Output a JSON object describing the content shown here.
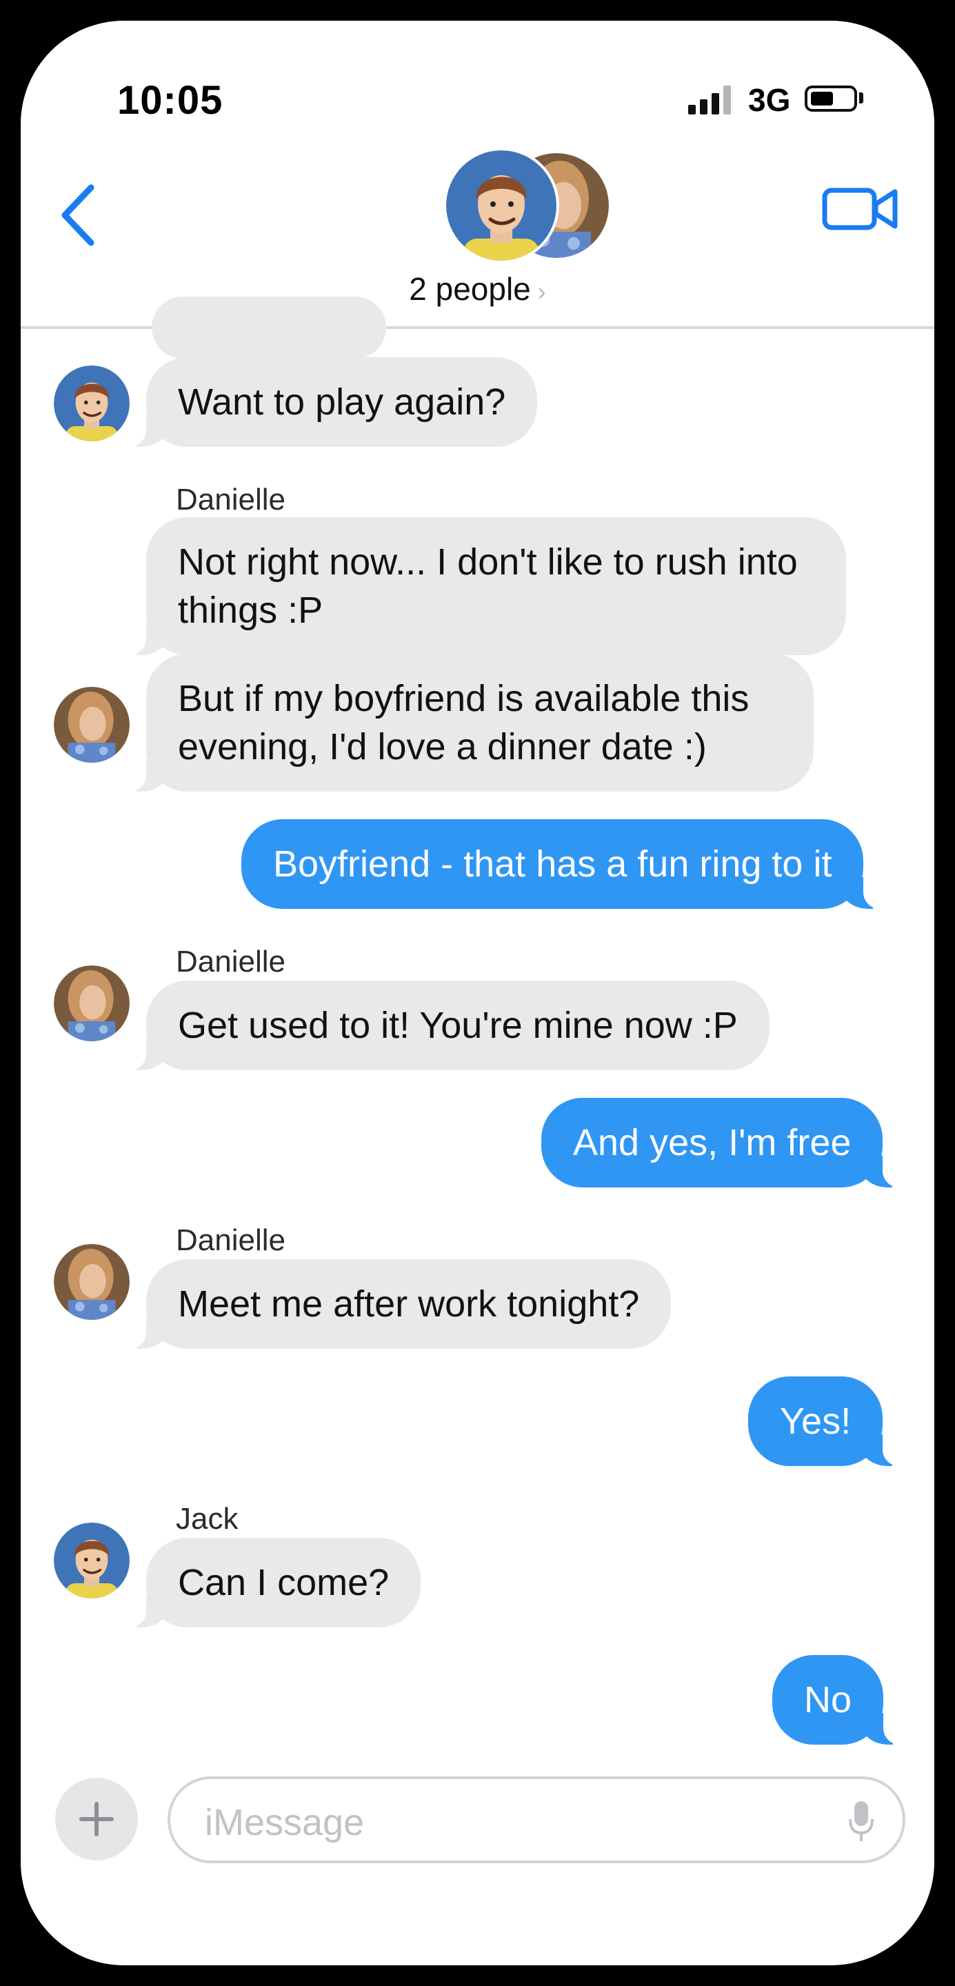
{
  "status_bar": {
    "time": "10:05",
    "network": "3G",
    "battery_level": 0.55
  },
  "header": {
    "group_label": "2 people",
    "chevron": "›",
    "back_icon": "chevron-left-icon",
    "video_icon": "video-camera-icon"
  },
  "messages": [
    {
      "sender": "Jack",
      "direction": "incoming",
      "text": "Want to play again?",
      "show_name": false
    },
    {
      "sender": "Danielle",
      "direction": "incoming",
      "text": "Not right now... I don't like to rush into things :P",
      "show_name": true
    },
    {
      "sender": "Danielle",
      "direction": "incoming",
      "text": "But if my boyfriend is available this evening, I'd love a dinner date :)",
      "show_name": false
    },
    {
      "sender": "me",
      "direction": "outgoing",
      "text": "Boyfriend - that has a fun ring to it"
    },
    {
      "sender": "Danielle",
      "direction": "incoming",
      "text": "Get used to it!  You're mine now :P",
      "show_name": true
    },
    {
      "sender": "me",
      "direction": "outgoing",
      "text": "And yes, I'm free"
    },
    {
      "sender": "Danielle",
      "direction": "incoming",
      "text": "Meet me after work tonight?",
      "show_name": true
    },
    {
      "sender": "me",
      "direction": "outgoing",
      "text": "Yes!"
    },
    {
      "sender": "Jack",
      "direction": "incoming",
      "text": "Can I come?",
      "show_name": true
    },
    {
      "sender": "me",
      "direction": "outgoing",
      "text": "No"
    }
  ],
  "names": {
    "danielle": "Danielle",
    "jack": "Jack"
  },
  "compose": {
    "placeholder": "iMessage",
    "add_icon": "plus-icon",
    "mic_icon": "microphone-icon"
  },
  "colors": {
    "outgoing_bubble": "#2f96f3",
    "incoming_bubble": "#e9e9eb",
    "accent": "#1a7cf0"
  }
}
